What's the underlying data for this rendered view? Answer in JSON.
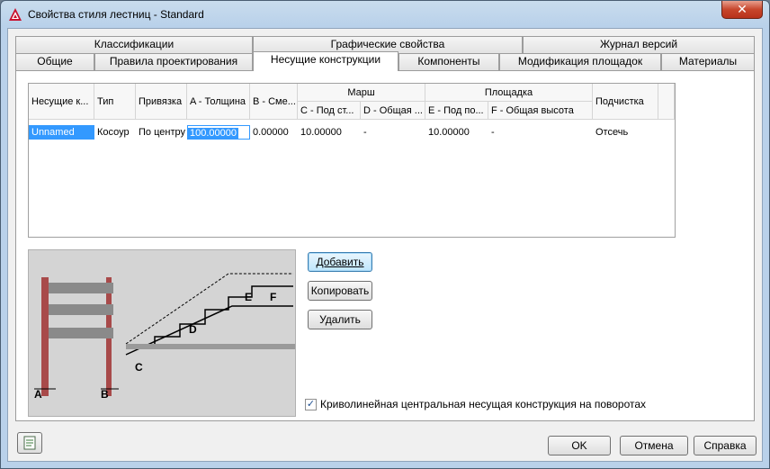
{
  "window": {
    "title": "Свойства стиля лестниц - Standard",
    "close_label": "✕"
  },
  "tabs_row1": [
    {
      "label": "Классификации"
    },
    {
      "label": "Графические свойства"
    },
    {
      "label": "Журнал версий"
    }
  ],
  "tabs_row2": [
    {
      "label": "Общие"
    },
    {
      "label": "Правила проектирования"
    },
    {
      "label": "Несущие конструкции",
      "active": true
    },
    {
      "label": "Компоненты"
    },
    {
      "label": "Модификация площадок"
    },
    {
      "label": "Материалы"
    }
  ],
  "grid": {
    "headers": {
      "col1": "Несущие к...",
      "col2": "Тип",
      "col3": "Привязка",
      "col4": "A - Толщина",
      "col5": "B - Сме...",
      "group_flight": "Марш",
      "col6": "C - Под ст...",
      "col7": "D - Общая ...",
      "group_landing": "Площадка",
      "col8": "E - Под по...",
      "col9": "F - Общая высота",
      "col10": "Подчистка"
    },
    "rows": [
      {
        "name": "Unnamed",
        "type": "Косоур",
        "anchor": "По центру",
        "thickness": "100.00000",
        "offset": "0.00000",
        "flight_c": "10.00000",
        "flight_d": "-",
        "landing_e": "10.00000",
        "landing_f": "-",
        "cleanup": "Отсечь"
      }
    ]
  },
  "illustration": {
    "labels": {
      "a": "A",
      "b": "B",
      "c": "C",
      "d": "D",
      "e": "E",
      "f": "F"
    }
  },
  "buttons": {
    "add": "Добавить",
    "copy": "Копировать",
    "delete": "Удалить",
    "ok": "OK",
    "cancel": "Отмена",
    "help": "Справка"
  },
  "checkbox": {
    "label": "Криволинейная центральная несущая конструкция на поворотах",
    "checked": true,
    "mark": "✓"
  },
  "colors": {
    "selection": "#3399ff",
    "title_bar": "#b9d1ea"
  }
}
